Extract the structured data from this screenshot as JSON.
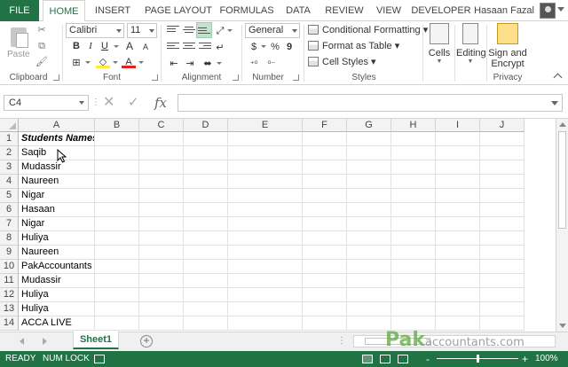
{
  "colors": {
    "accent": "#217346",
    "header_bg": "#f3f3f3",
    "gridline": "#e2e2e2"
  },
  "ribbon_tabs": [
    "FILE",
    "HOME",
    "INSERT",
    "PAGE LAYOUT",
    "FORMULAS",
    "DATA",
    "REVIEW",
    "VIEW",
    "DEVELOPER"
  ],
  "active_tab": "HOME",
  "user": {
    "name": "Hasaan Fazal"
  },
  "ribbon": {
    "clipboard": {
      "paste_label": "Paste",
      "group_label": "Clipboard"
    },
    "font": {
      "name": "Calibri",
      "size": "11",
      "bold": "B",
      "italic": "I",
      "underline": "U",
      "grow": "A",
      "shrink": "A",
      "font_color": "A",
      "group_label": "Font"
    },
    "alignment": {
      "group_label": "Alignment"
    },
    "number": {
      "format": "General",
      "currency": "$",
      "percent": "%",
      "comma": "9",
      "group_label": "Number"
    },
    "styles": {
      "conditional_formatting": "Conditional Formatting",
      "format_as_table": "Format as Table",
      "cell_styles": "Cell Styles",
      "group_label": "Styles"
    },
    "cells": {
      "label": "Cells"
    },
    "editing": {
      "label": "Editing"
    },
    "privacy": {
      "label_line1": "Sign and",
      "label_line2": "Encrypt",
      "group_label": "Privacy"
    }
  },
  "formula_bar": {
    "name_box": "C4",
    "fx_label": "fx",
    "formula": ""
  },
  "grid": {
    "columns": [
      "A",
      "B",
      "C",
      "D",
      "E",
      "F",
      "G",
      "H",
      "I",
      "J"
    ],
    "rows": [
      {
        "num": "1",
        "a": "Students Names"
      },
      {
        "num": "2",
        "a": "Saqib"
      },
      {
        "num": "3",
        "a": "Mudassir"
      },
      {
        "num": "4",
        "a": "Naureen"
      },
      {
        "num": "5",
        "a": "Nigar"
      },
      {
        "num": "6",
        "a": "Hasaan"
      },
      {
        "num": "7",
        "a": "Nigar"
      },
      {
        "num": "8",
        "a": "Huliya"
      },
      {
        "num": "9",
        "a": "Naureen"
      },
      {
        "num": "10",
        "a": "PakAccountants"
      },
      {
        "num": "11",
        "a": "Mudassir"
      },
      {
        "num": "12",
        "a": "Huliya"
      },
      {
        "num": "13",
        "a": "Huliya"
      },
      {
        "num": "14",
        "a": "ACCA LIVE"
      }
    ]
  },
  "sheets": {
    "active": "Sheet1",
    "add_label": "+"
  },
  "watermark": {
    "brand": "Pak",
    "rest": "accountants.com"
  },
  "status": {
    "ready": "READY",
    "num_lock": "NUM LOCK",
    "zoom_minus": "-",
    "zoom_plus": "+",
    "zoom": "100%"
  }
}
